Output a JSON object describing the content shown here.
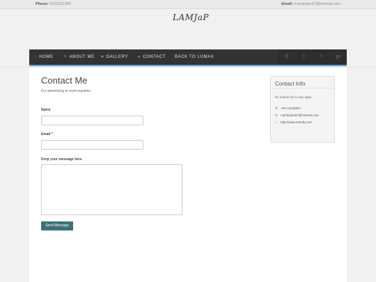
{
  "topbar": {
    "phone_label": "Phone:",
    "phone_value": "0163322345",
    "email_label": "Email:",
    "email_value": "mandylam97@hotmail.com"
  },
  "logo": {
    "text": "LAMJaP"
  },
  "nav": {
    "items": [
      {
        "label": "HOME",
        "icon": "home-icon"
      },
      {
        "label": "ABOUT ME",
        "icon": "pencil-icon"
      },
      {
        "label": "GALLERY",
        "icon": "folder-icon"
      },
      {
        "label": "CONTACT",
        "icon": "chat-icon"
      },
      {
        "label": "BACK TO LUMAX",
        "icon": ""
      }
    ],
    "social": [
      {
        "name": "rss-icon",
        "glyph": "☰"
      },
      {
        "name": "twitter-icon",
        "glyph": "t"
      },
      {
        "name": "facebook-icon",
        "glyph": "f"
      },
      {
        "name": "google-plus-icon",
        "glyph": "g+"
      }
    ],
    "accent_color": "#5b9bd5"
  },
  "main": {
    "title": "Contact Me",
    "subtitle": "For advertising or work inquiries",
    "form": {
      "name_label": "Name",
      "name_value": "",
      "email_label": "Email *",
      "email_value": "",
      "message_label": "Drop your message here",
      "message_value": "",
      "submit_label": "Send Message",
      "submit_color": "#3d7176"
    }
  },
  "sidebar": {
    "panel_title": "Contact Info",
    "panel_text": "Do search me in any apps.",
    "contacts": [
      {
        "icon": "phone-icon",
        "text": "+60-12345567"
      },
      {
        "icon": "envelope-icon",
        "text": "mandylam97@hotmail.com"
      },
      {
        "icon": "home-icon",
        "text": "http://www.mandy.com"
      }
    ]
  }
}
